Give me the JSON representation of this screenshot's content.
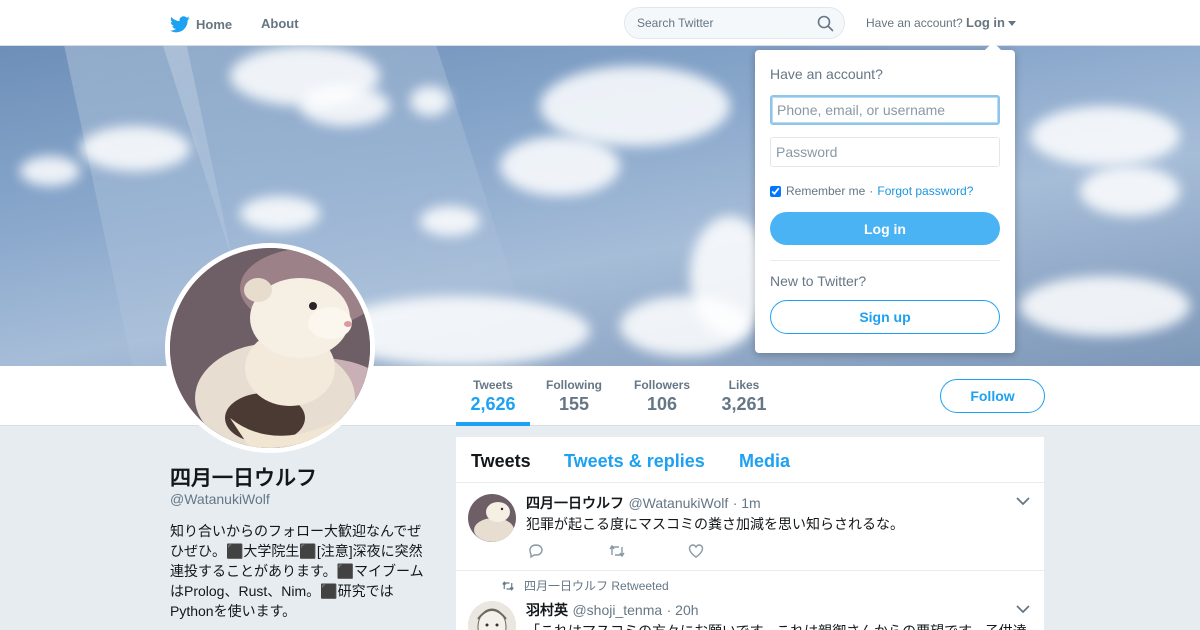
{
  "nav": {
    "home_label": "Home",
    "about_label": "About",
    "search_placeholder": "Search Twitter",
    "have_account": "Have an account?",
    "login_label": "Log in"
  },
  "profile": {
    "name": "四月一日ウルフ",
    "handle": "@WatanukiWolf",
    "bio": "知り合いからのフォロー大歓迎なんでぜひぜひ。⬛大学院生⬛[注意]深夜に突然連投することがあります。⬛マイブームはProlog、Rust、Nim。⬛研究ではPythonを使います。",
    "stats": [
      {
        "label": "Tweets",
        "value": "2,626",
        "active": true
      },
      {
        "label": "Following",
        "value": "155",
        "active": false
      },
      {
        "label": "Followers",
        "value": "106",
        "active": false
      },
      {
        "label": "Likes",
        "value": "3,261",
        "active": false
      }
    ],
    "follow_label": "Follow"
  },
  "timeline": {
    "tabs": [
      {
        "label": "Tweets",
        "active": true
      },
      {
        "label": "Tweets & replies",
        "active": false
      },
      {
        "label": "Media",
        "active": false
      }
    ],
    "tweets": [
      {
        "name": "四月一日ウルフ",
        "handle": "@WatanukiWolf",
        "time": "· 1m",
        "text": "犯罪が起こる度にマスコミの粪さ加減を思い知らされるな。"
      },
      {
        "retweet_by": "四月一日ウルフ",
        "retweet_label": "Retweeted",
        "name": "羽村英",
        "handle": "@shoji_tenma",
        "time": "· 20h",
        "text": "「これはマスコミの方々にお願いです。これは親御さんからの要望です。子供達"
      }
    ]
  },
  "login_dropdown": {
    "title": "Have an account?",
    "username_placeholder": "Phone, email, or username",
    "password_placeholder": "Password",
    "remember_label": "Remember me",
    "separator": "·",
    "forgot_label": "Forgot password?",
    "login_button": "Log in",
    "new_label": "New to Twitter?",
    "signup_button": "Sign up"
  },
  "colors": {
    "accent": "#1da1f2",
    "login_button": "#4ab3f4",
    "page_bg": "#e6ecf0"
  }
}
